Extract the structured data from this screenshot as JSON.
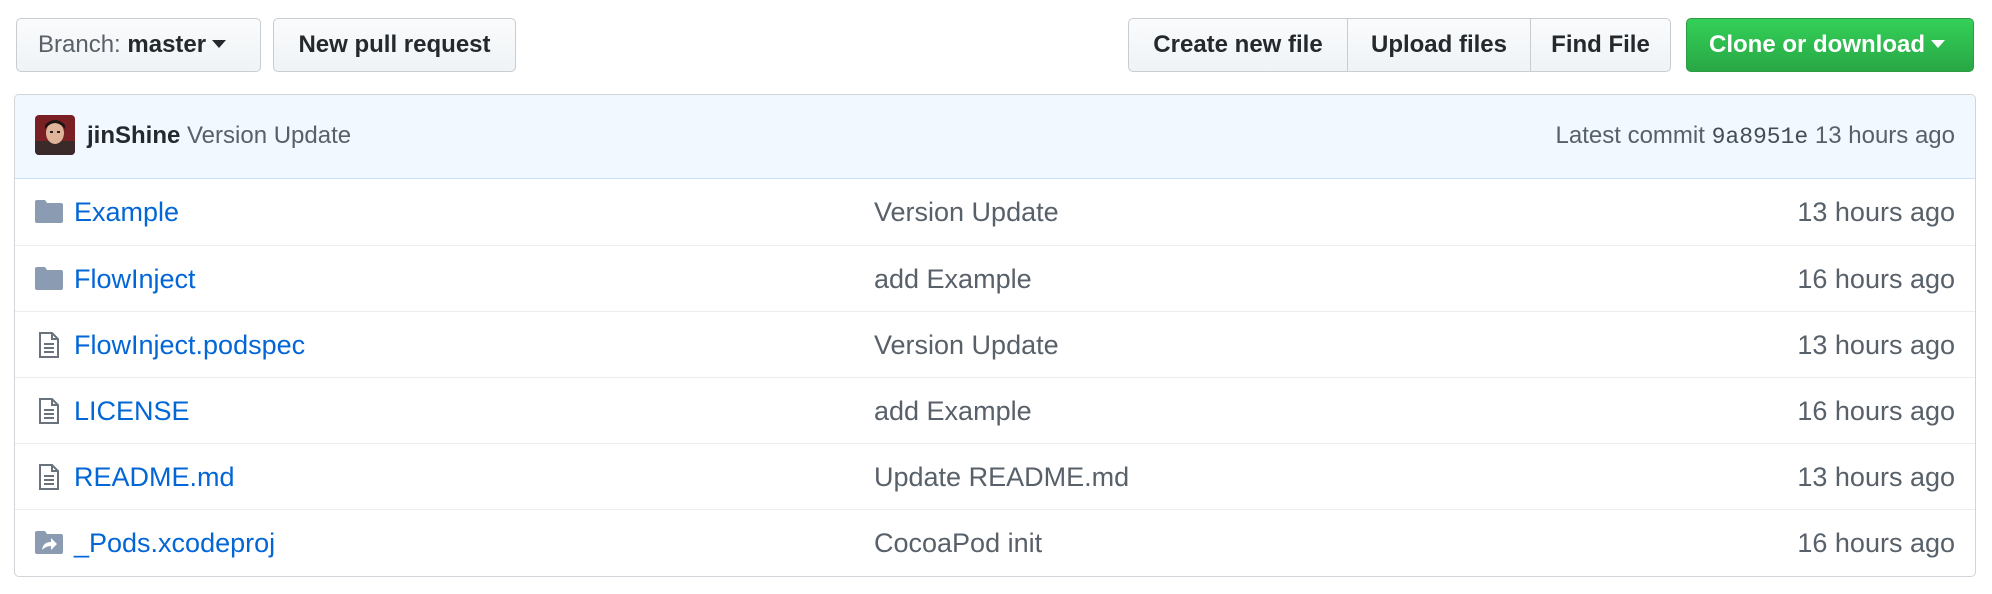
{
  "toolbar": {
    "branch_prefix": "Branch:",
    "branch_name": "master",
    "new_pull_request": "New pull request",
    "create_new_file": "Create new file",
    "upload_files": "Upload files",
    "find_file": "Find File",
    "clone_or_download": "Clone or download"
  },
  "commit": {
    "author": "jinShine",
    "message": "Version Update",
    "latest_label": "Latest commit",
    "sha": "9a8951e",
    "age": "13 hours ago"
  },
  "files": [
    {
      "type": "folder",
      "icon": "folder-icon",
      "name": "Example",
      "message": "Version Update",
      "age": "13 hours ago"
    },
    {
      "type": "folder",
      "icon": "folder-icon",
      "name": "FlowInject",
      "message": "add Example",
      "age": "16 hours ago"
    },
    {
      "type": "file",
      "icon": "file-icon",
      "name": "FlowInject.podspec",
      "message": "Version Update",
      "age": "13 hours ago"
    },
    {
      "type": "file",
      "icon": "file-icon",
      "name": "LICENSE",
      "message": "add Example",
      "age": "16 hours ago"
    },
    {
      "type": "file",
      "icon": "file-icon",
      "name": "README.md",
      "message": "Update README.md",
      "age": "13 hours ago"
    },
    {
      "type": "symlink",
      "icon": "symlink-folder-icon",
      "name": "_Pods.xcodeproj",
      "message": "CocoaPod init",
      "age": "16 hours ago"
    }
  ],
  "colors": {
    "link": "#0366d6",
    "muted": "#586069",
    "commit_bar_bg": "#f1f8ff",
    "clone_button": "#28a745"
  }
}
